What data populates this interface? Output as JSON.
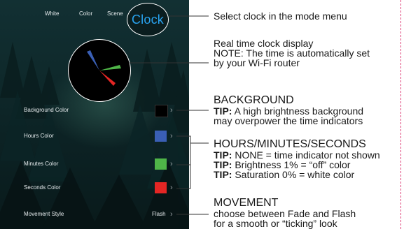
{
  "nav": {
    "items": [
      "White",
      "Color",
      "Scene"
    ],
    "active": "Clock"
  },
  "rows": [
    {
      "label": "Background Color",
      "swatch": "#000000"
    },
    {
      "label": "Hours Color",
      "swatch": "#3a5fb5"
    },
    {
      "label": "Minutes Color",
      "swatch": "#4fb548"
    },
    {
      "label": "Seconds Color",
      "swatch": "#e42624"
    },
    {
      "label": "Movement Style",
      "value": "Flash"
    }
  ],
  "clock_hands": {
    "hours_color": "#3a5fb5",
    "minutes_color": "#4fb548",
    "seconds_color": "#e42624"
  },
  "annotations": {
    "clock_select": "Select clock in the mode menu",
    "display_line1": "Real time clock display",
    "display_line2": "NOTE: The time is automatically set",
    "display_line3": "by your Wi-Fi router",
    "bg_title": "BACKGROUND",
    "bg_tip_label": "TIP:",
    "bg_tip_text1": " A high brightness background",
    "bg_tip_text2": "may overpower the time indicators",
    "hms_title": "HOURS/MINUTES/SECONDS",
    "hms_tip_label": "TIP:",
    "hms_tip1": " NONE = time indicator not shown",
    "hms_tip2": " Brightness 1% = “off” color",
    "hms_tip3": " Saturation 0% = white color",
    "move_title": "MOVEMENT",
    "move_text1": "choose between Fade and Flash",
    "move_text2": "for a smooth or “ticking” look"
  },
  "colors": {
    "accent_blue": "#29a3f0",
    "connector": "#333333",
    "border_dash": "#e0417a"
  }
}
